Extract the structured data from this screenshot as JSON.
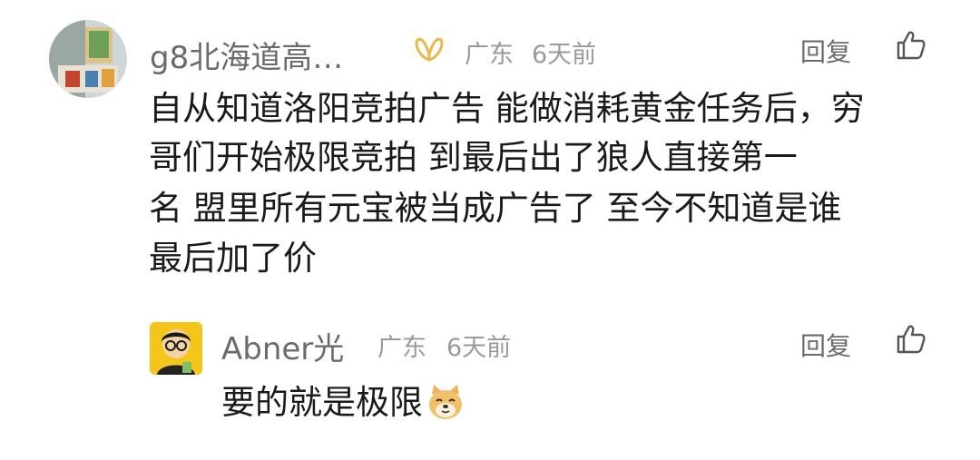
{
  "comment": {
    "username": "g8北海道高…",
    "location": "广东",
    "time": "6天前",
    "reply_label": "回复",
    "lines": [
      "自从知道洛阳竞拍广告 能做消耗黄金任务后，穷",
      "哥们开始极限竞拍 到最后出了狼人直接第一",
      "名 盟里所有元宝被当成广告了 至今不知道是谁",
      "最后加了价"
    ],
    "badge_icon": "gold-wings-icon",
    "badge_color": "#e8b84a"
  },
  "reply": {
    "username": "Abner光",
    "location": "广东",
    "time": "6天前",
    "reply_label": "回复",
    "text": "要的就是极限",
    "emoji": "doge-emoji-icon"
  }
}
